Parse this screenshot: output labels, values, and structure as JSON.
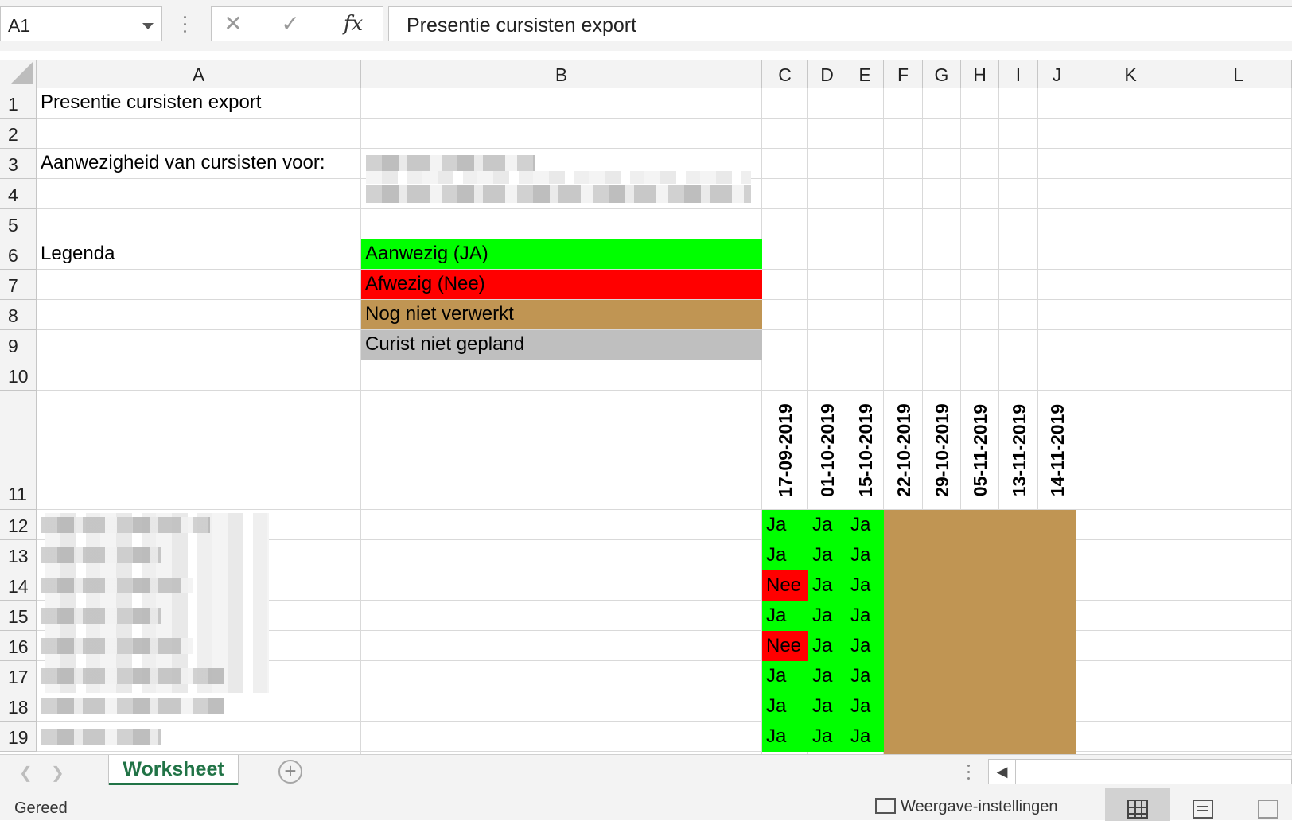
{
  "formula_bar": {
    "name_box": "A1",
    "cancel_icon": "✕",
    "enter_icon": "✓",
    "fx_label": "fx",
    "formula_value": "Presentie cursisten export"
  },
  "columns": [
    "A",
    "B",
    "C",
    "D",
    "E",
    "F",
    "G",
    "H",
    "I",
    "J",
    "K",
    "L"
  ],
  "rows": [
    "1",
    "2",
    "3",
    "4",
    "5",
    "6",
    "7",
    "8",
    "9",
    "10",
    "11",
    "12",
    "13",
    "14",
    "15",
    "16",
    "17",
    "18",
    "19"
  ],
  "cells": {
    "a1": "Presentie cursisten export",
    "a3": "Aanwezigheid van cursisten voor:",
    "a6": "Legenda"
  },
  "legend": {
    "present": "Aanwezig (JA)",
    "absent": "Afwezig (Nee)",
    "not_processed": "Nog niet verwerkt",
    "not_planned": "Curist niet gepland"
  },
  "colors": {
    "present": "#00ff00",
    "absent": "#ff0000",
    "not_processed": "#c09553",
    "not_planned": "#bfbfbf",
    "accent": "#217346"
  },
  "dates": [
    "17-09-2019",
    "01-10-2019",
    "15-10-2019",
    "22-10-2019",
    "29-10-2019",
    "05-11-2019",
    "13-11-2019",
    "14-11-2019"
  ],
  "attendance": [
    [
      "Ja",
      "Ja",
      "Ja"
    ],
    [
      "Ja",
      "Ja",
      "Ja"
    ],
    [
      "Nee",
      "Ja",
      "Ja"
    ],
    [
      "Ja",
      "Ja",
      "Ja"
    ],
    [
      "Nee",
      "Ja",
      "Ja"
    ],
    [
      "Ja",
      "Ja",
      "Ja"
    ],
    [
      "Ja",
      "Ja",
      "Ja"
    ],
    [
      "Ja",
      "Ja",
      "Ja"
    ]
  ],
  "tabs": {
    "sheet_name": "Worksheet",
    "add_label": "+"
  },
  "status": {
    "ready": "Gereed",
    "display_settings": "Weergave-instellingen"
  }
}
